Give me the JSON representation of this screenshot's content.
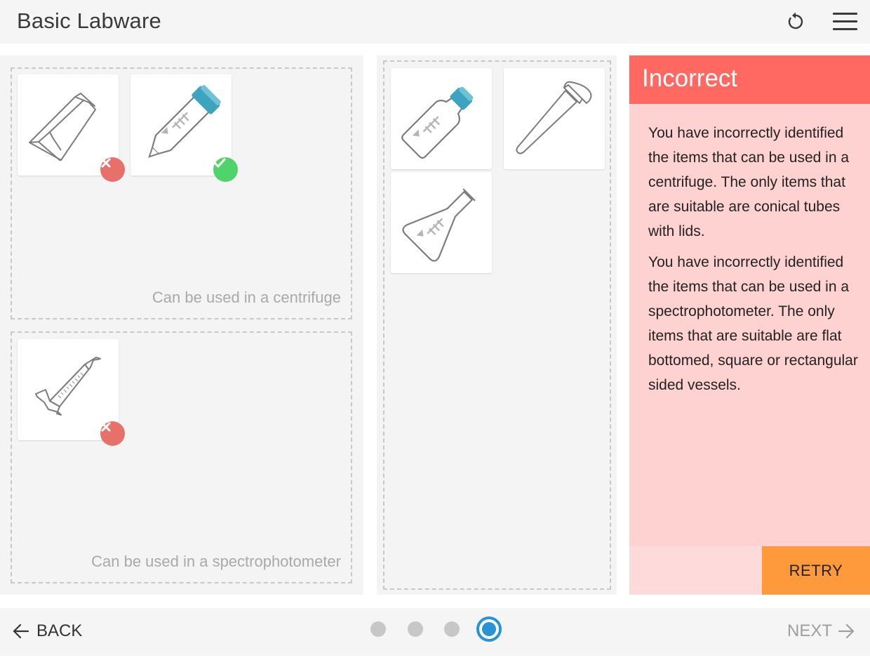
{
  "header": {
    "title": "Basic Labware",
    "reset_icon": "reset-icon",
    "menu_icon": "hamburger-menu-icon"
  },
  "zones": {
    "centrifuge_label": "Can be used in a centrifuge",
    "spectro_label": "Can be used in a spectrophotometer"
  },
  "items": {
    "cuvette": {
      "icon": "cuvette-icon",
      "status": "incorrect"
    },
    "conical_tube": {
      "icon": "conical-tube-with-lid-icon",
      "status": "correct"
    },
    "graduated_cylinder": {
      "icon": "graduated-cylinder-icon",
      "status": "incorrect"
    },
    "media_bottle": {
      "icon": "media-bottle-icon"
    },
    "microcentrifuge_tube": {
      "icon": "microcentrifuge-tube-icon"
    },
    "flask": {
      "icon": "erlenmeyer-flask-icon"
    }
  },
  "feedback": {
    "title": "Incorrect",
    "paragraphs": [
      "You have incorrectly identified the items that can be used in a centrifuge. The only items that are suitable are conical tubes with lids.",
      "You have incorrectly identified the items that can be used in a spectrophotometer. The only items that are suitable are flat bottomed, square or rectangular sided vessels."
    ],
    "retry_label": "RETRY",
    "header_color": "#ff6961",
    "body_color": "#ffd2d2",
    "retry_color": "#ff9a3c"
  },
  "footer": {
    "back_label": "BACK",
    "next_label": "NEXT",
    "pages": 4,
    "current_page": 4,
    "active_color": "#2a93d5"
  },
  "status_colors": {
    "correct": "#4fd36b",
    "incorrect": "#e8706a"
  }
}
